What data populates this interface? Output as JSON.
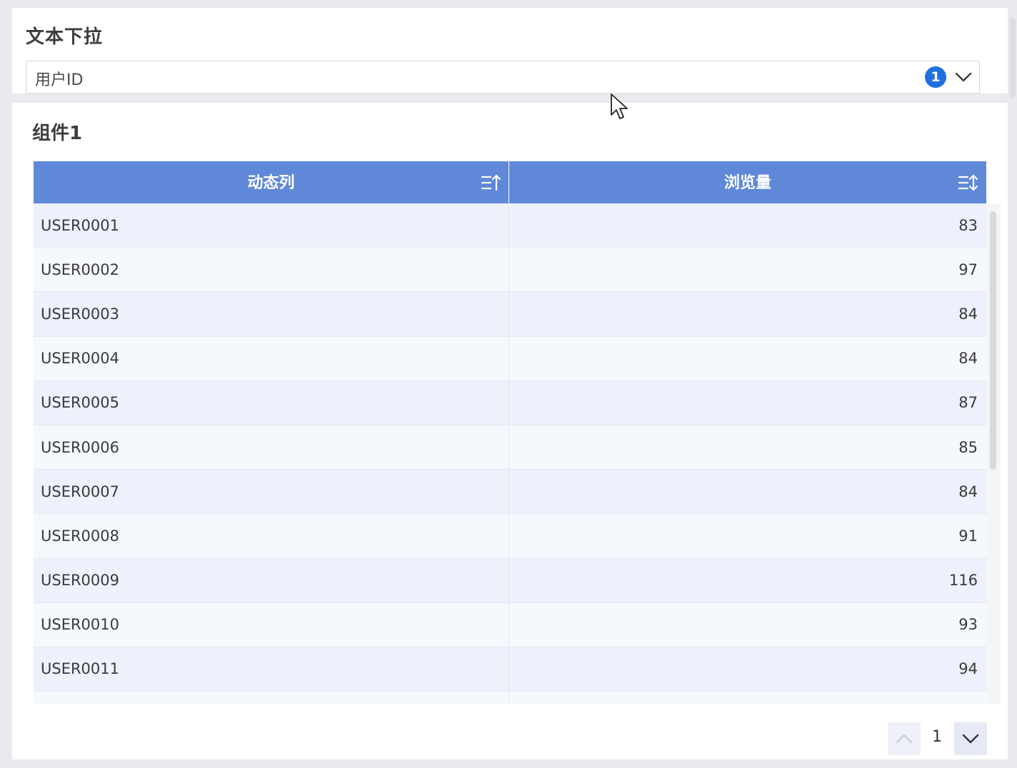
{
  "filter": {
    "title": "文本下拉",
    "selected_value": "用户ID",
    "selected_count": "1",
    "dropdown_icon": "chevron-down-icon"
  },
  "widget": {
    "title": "组件1",
    "columns": [
      {
        "label": "动态列",
        "sort_icon": "sort-ascending-icon"
      },
      {
        "label": "浏览量",
        "sort_icon": "sort-toggle-icon"
      }
    ],
    "rows": [
      {
        "user": "USER0001",
        "views": "83"
      },
      {
        "user": "USER0002",
        "views": "97"
      },
      {
        "user": "USER0003",
        "views": "84"
      },
      {
        "user": "USER0004",
        "views": "84"
      },
      {
        "user": "USER0005",
        "views": "87"
      },
      {
        "user": "USER0006",
        "views": "85"
      },
      {
        "user": "USER0007",
        "views": "84"
      },
      {
        "user": "USER0008",
        "views": "91"
      },
      {
        "user": "USER0009",
        "views": "116"
      },
      {
        "user": "USER0010",
        "views": "93"
      },
      {
        "user": "USER0011",
        "views": "94"
      },
      {
        "user": "",
        "views": ""
      }
    ]
  },
  "pagination": {
    "current_page": "1",
    "prev_icon": "chevron-up-icon",
    "next_icon": "chevron-down-icon"
  },
  "colors": {
    "header_bg": "#5f88d8",
    "badge_bg": "#1f6fe0",
    "row_odd": "#ecf1fc",
    "row_even": "#f5f8fd"
  }
}
